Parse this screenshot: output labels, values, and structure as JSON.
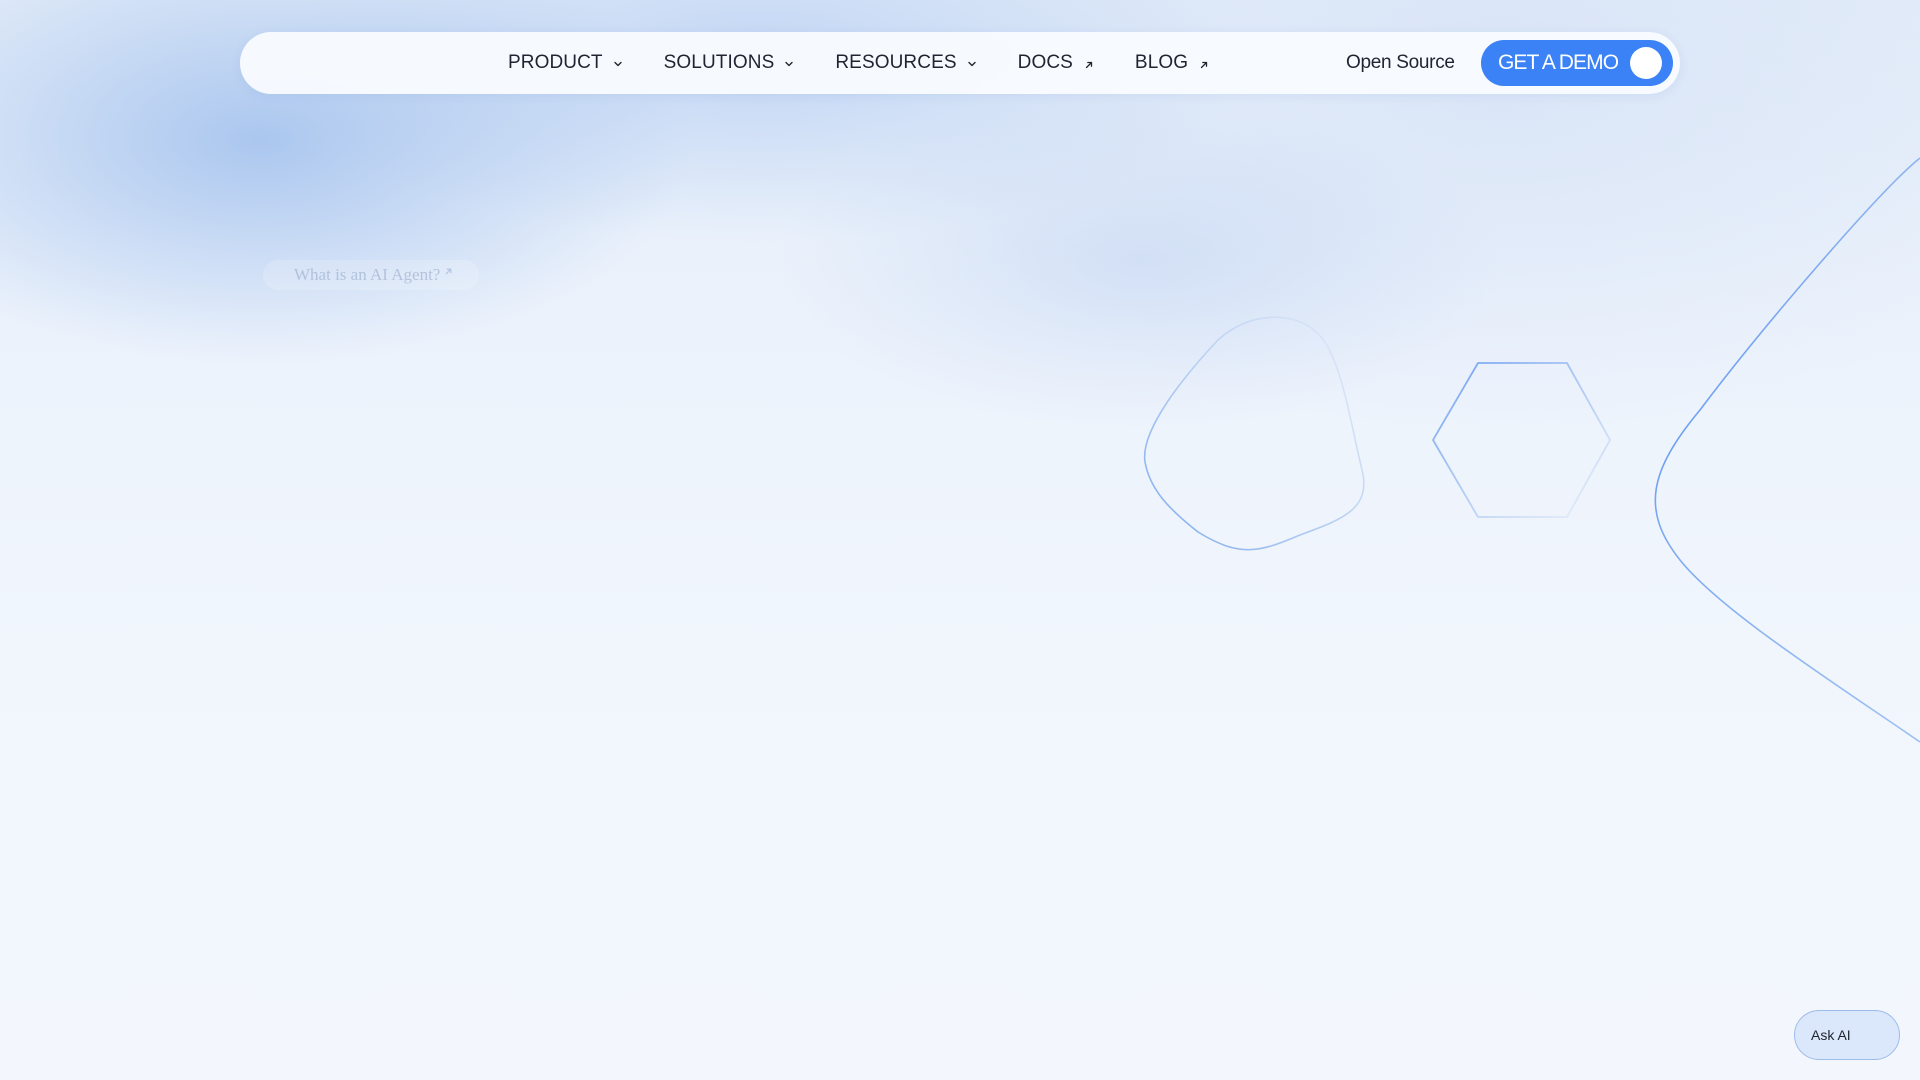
{
  "nav": {
    "items": [
      {
        "label": "PRODUCT",
        "icon": "chevron-down-icon"
      },
      {
        "label": "SOLUTIONS",
        "icon": "chevron-down-icon"
      },
      {
        "label": "RESOURCES",
        "icon": "chevron-down-icon"
      },
      {
        "label": "DOCS",
        "icon": "external-link-icon"
      },
      {
        "label": "BLOG",
        "icon": "external-link-icon"
      }
    ],
    "open_source_label": "Open Source",
    "cta_label": "GET A DEMO"
  },
  "hero": {
    "pill_label": "What is an AI Agent?"
  },
  "ask_ai": {
    "label": "Ask AI"
  },
  "colors": {
    "accent": "#3b82f6",
    "text": "#1f2430",
    "shape_stroke": "#7fa9ec"
  }
}
